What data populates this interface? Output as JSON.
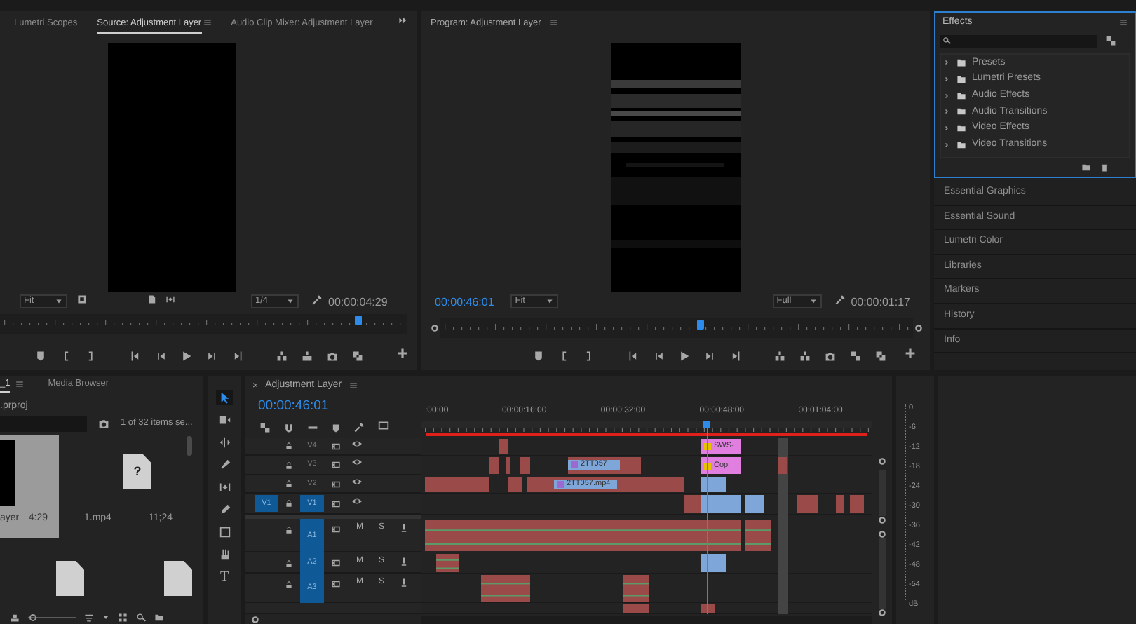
{
  "source_monitor": {
    "tabs": [
      {
        "label": "Lumetri Scopes",
        "selected": false
      },
      {
        "label": "Source: Adjustment Layer",
        "selected": true
      },
      {
        "label": "Audio Clip Mixer: Adjustment Layer",
        "selected": false
      }
    ],
    "zoom": "Fit",
    "resolution": "1/4",
    "duration": "00:00:04:29",
    "playhead": {
      "level": 0.88
    }
  },
  "program_monitor": {
    "title": "Program: Adjustment Layer",
    "timecode": "00:00:46:01",
    "zoom": "Fit",
    "resolution": "Full",
    "duration": "00:00:01:17",
    "playhead": {
      "level": 0.55
    }
  },
  "effects": {
    "title": "Effects",
    "active": true,
    "items": [
      {
        "label": "Presets",
        "kind": "preset"
      },
      {
        "label": "Lumetri Presets",
        "kind": "preset"
      },
      {
        "label": "Audio Effects",
        "kind": "folder"
      },
      {
        "label": "Audio Transitions",
        "kind": "folder"
      },
      {
        "label": "Video Effects",
        "kind": "folder"
      },
      {
        "label": "Video Transitions",
        "kind": "folder"
      }
    ]
  },
  "panels": [
    "Essential Graphics",
    "Essential Sound",
    "Lumetri Color",
    "Libraries",
    "Markers",
    "History",
    "Info"
  ],
  "project": {
    "tabs": [
      {
        "label": "_1",
        "selected": true
      },
      {
        "label": "Media Browser",
        "selected": false
      }
    ],
    "path": ".prproj",
    "count": "1 of 32 items se...",
    "thumbnail_zoom": {
      "level": 0.05
    },
    "items": [
      {
        "kind": "clip",
        "name": "ayer",
        "duration": "4:29",
        "selected": true
      },
      {
        "kind": "missing",
        "badge": "?",
        "name": "1.mp4",
        "duration": "11;24",
        "selected": false
      },
      {
        "kind": "file",
        "selected": false
      },
      {
        "kind": "file",
        "selected": false
      }
    ]
  },
  "tools": [
    {
      "kind": "selection",
      "selected": true
    },
    {
      "kind": "track-select",
      "selected": false
    },
    {
      "kind": "ripple",
      "selected": false
    },
    {
      "kind": "razor",
      "selected": false
    },
    {
      "kind": "slip",
      "selected": false
    },
    {
      "kind": "pen",
      "selected": false
    },
    {
      "kind": "rectangle",
      "selected": false
    },
    {
      "kind": "hand",
      "selected": false
    },
    {
      "kind": "type",
      "glyph": "T",
      "selected": false
    }
  ],
  "timeline": {
    "close": "×",
    "title": "Adjustment Layer",
    "timecode": "00:00:46:01",
    "ruler": [
      ":00:00",
      "00:00:16:00",
      "00:00:32:00",
      "00:00:48:00",
      "00:01:04:00"
    ],
    "playhead": {
      "level": 0.634
    },
    "video_tracks": [
      {
        "name": "V4",
        "targeted": false,
        "clips": [
          {
            "label": "SWS-",
            "color": "#e07fe0"
          }
        ]
      },
      {
        "name": "V3",
        "targeted": false,
        "clips": [
          {
            "label": "2TT057",
            "color": "#7fa6d9"
          },
          {
            "label": "Copi",
            "color": "#e07fe0"
          }
        ]
      },
      {
        "name": "V2",
        "targeted": false,
        "clips": [
          {
            "label": "2TT057.mp4",
            "color": "#7fa6d9"
          }
        ]
      },
      {
        "name": "V1",
        "source": "V1",
        "targeted": true
      }
    ],
    "audio_tracks": [
      {
        "name": "A1",
        "targeted": true,
        "mute": "M",
        "solo": "S"
      },
      {
        "name": "A2",
        "targeted": true,
        "mute": "M",
        "solo": "S"
      },
      {
        "name": "A3",
        "targeted": true,
        "mute": "M",
        "solo": "S"
      }
    ]
  },
  "meter": {
    "scale": [
      "0",
      "-6",
      "-12",
      "-18",
      "-24",
      "-30",
      "-36",
      "-42",
      "-48",
      "-54",
      "dB"
    ]
  }
}
